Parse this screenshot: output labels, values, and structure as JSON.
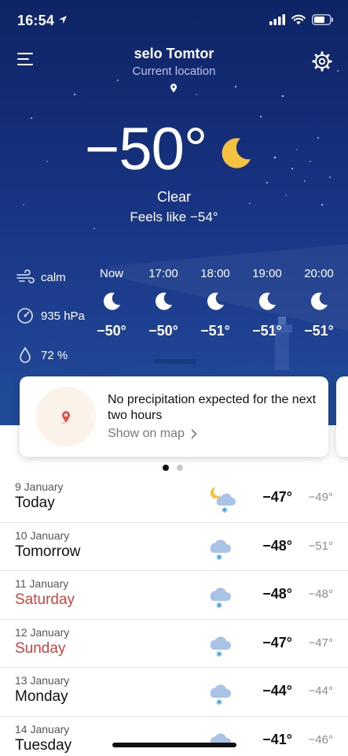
{
  "status_bar": {
    "time": "16:54"
  },
  "header": {
    "location_name": "selo Tomtor",
    "location_subtitle": "Current location"
  },
  "current": {
    "temperature": "−50°",
    "condition": "Clear",
    "feels_like": "Feels like −54°",
    "icon": "moon-icon"
  },
  "details": {
    "wind": "calm",
    "pressure": "935 hPa",
    "humidity": "72 %"
  },
  "hourly": [
    {
      "time": "Now",
      "icon": "moon-icon",
      "temp": "−50°"
    },
    {
      "time": "17:00",
      "icon": "moon-icon",
      "temp": "−50°"
    },
    {
      "time": "18:00",
      "icon": "moon-icon",
      "temp": "−51°"
    },
    {
      "time": "19:00",
      "icon": "moon-icon",
      "temp": "−51°"
    },
    {
      "time": "20:00",
      "icon": "moon-icon",
      "temp": "−51°"
    }
  ],
  "nowcast": {
    "message": "No precipitation expected for the next two hours",
    "link": "Show on map"
  },
  "pager": {
    "pages": 2,
    "active": 1
  },
  "daily": [
    {
      "date": "9 January",
      "day": "Today",
      "weekend": false,
      "icon": "snow-night-icon",
      "high": "−47°",
      "low": "−49°"
    },
    {
      "date": "10 January",
      "day": "Tomorrow",
      "weekend": false,
      "icon": "snow-cloud-icon",
      "high": "−48°",
      "low": "−51°"
    },
    {
      "date": "11 January",
      "day": "Saturday",
      "weekend": true,
      "icon": "snow-cloud-icon",
      "high": "−48°",
      "low": "−48°"
    },
    {
      "date": "12 January",
      "day": "Sunday",
      "weekend": true,
      "icon": "snow-cloud-icon",
      "high": "−47°",
      "low": "−47°"
    },
    {
      "date": "13 January",
      "day": "Monday",
      "weekend": false,
      "icon": "snow-cloud-icon",
      "high": "−44°",
      "low": "−44°"
    },
    {
      "date": "14 January",
      "day": "Tuesday",
      "weekend": false,
      "icon": "snow-cloud-icon",
      "high": "−41°",
      "low": "−46°"
    }
  ],
  "colors": {
    "sky_top": "#0f2466",
    "sky_bottom": "#234a9a",
    "moon": "#f6c341",
    "weekend": "#d0433e",
    "snowflake": "#3aa0e6",
    "cloud": "#a9c3e6"
  }
}
